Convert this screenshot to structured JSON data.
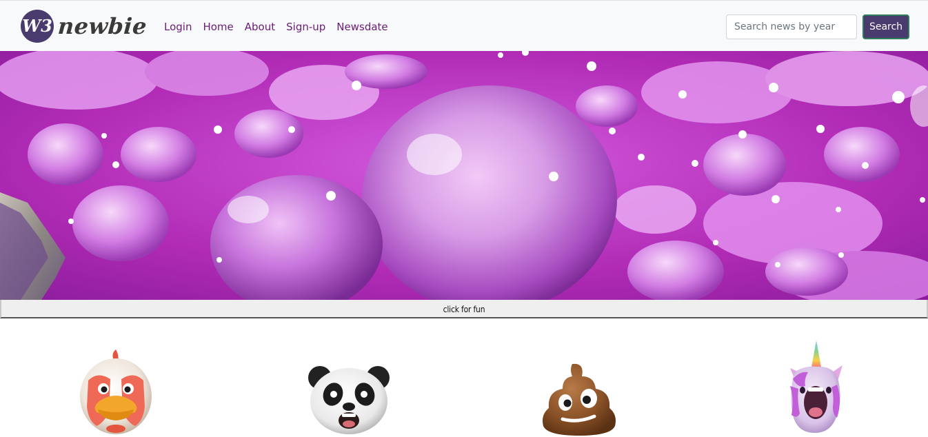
{
  "navbar": {
    "brand_logo_text": "W3",
    "brand_name": "newbie",
    "links": [
      "Login",
      "Home",
      "About",
      "Sign-up",
      "Newsdate"
    ],
    "search": {
      "placeholder": "Search news by year",
      "value": "",
      "button_label": "Search"
    }
  },
  "hero": {
    "image": "purple-water-droplets-photo"
  },
  "fun_bar": {
    "label": "click for fun"
  },
  "emojis": [
    {
      "name": "chicken-memoji"
    },
    {
      "name": "panda-memoji"
    },
    {
      "name": "poop-memoji"
    },
    {
      "name": "unicorn-memoji"
    }
  ],
  "colors": {
    "navbar_bg": "#f8f9fa",
    "link": "#6a1b78",
    "search_button_bg": "#4a3b6e",
    "search_button_border": "#2e7d5b",
    "hero_magenta": "#b12bb5"
  }
}
